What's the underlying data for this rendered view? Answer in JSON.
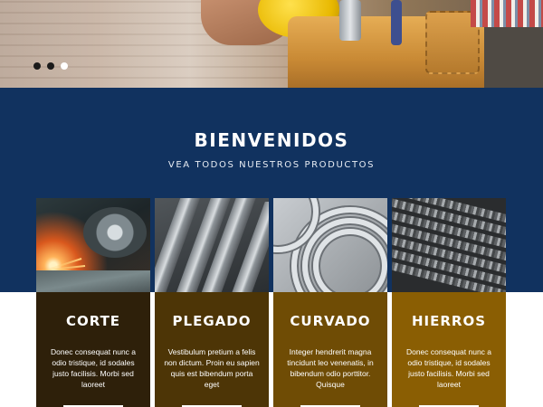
{
  "hero": {
    "slides": [
      {
        "active": false
      },
      {
        "active": false
      },
      {
        "active": true
      }
    ]
  },
  "welcome": {
    "title": "BIENVENIDOS",
    "subtitle": "VEA TODOS NUESTROS PRODUCTOS"
  },
  "cards": [
    {
      "title": "CORTE",
      "text": "Donec consequat nunc a odio tristique, id sodales justo facilisis. Morbi sed laoreet",
      "image": "cutting-sparks-image",
      "color": "#2e200a"
    },
    {
      "title": "PLEGADO",
      "text": "Vestibulum pretium a felis non dictum. Proin eu sapien quis est bibendum porta eget",
      "image": "angle-iron-image",
      "color": "#4d3506"
    },
    {
      "title": "CURVADO",
      "text": "Integer hendrerit magna tincidunt leo venenatis, in bibendum odio porttitor. Quisque",
      "image": "steel-rings-image",
      "color": "#6f4c05"
    },
    {
      "title": "HIERROS",
      "text": "Donec consequat nunc a odio tristique, id sodales justo facilisis. Morbi sed laoreet",
      "image": "rebar-image",
      "color": "#8a5e03"
    }
  ],
  "colors": {
    "band": "#11325f",
    "text": "#ffffff"
  }
}
